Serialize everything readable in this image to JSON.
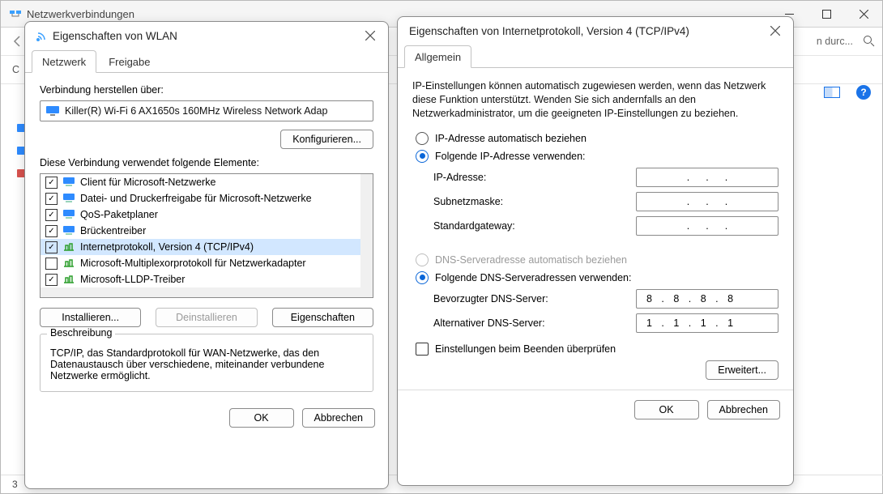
{
  "mainwin": {
    "title": "Netzwerkverbindungen",
    "back_icon": "arrow-left-icon",
    "search_placeholder": "n durc...",
    "status_count": "3"
  },
  "wlan": {
    "title": "Eigenschaften von WLAN",
    "tabs": {
      "network": "Netzwerk",
      "sharing": "Freigabe"
    },
    "connect_using": "Verbindung herstellen über:",
    "adapter": "Killer(R) Wi-Fi 6 AX1650s 160MHz Wireless Network Adap",
    "configure": "Konfigurieren...",
    "uses_items": "Diese Verbindung verwendet folgende Elemente:",
    "items": [
      {
        "checked": true,
        "label": "Client für Microsoft-Netzwerke"
      },
      {
        "checked": true,
        "label": "Datei- und Druckerfreigabe für Microsoft-Netzwerke"
      },
      {
        "checked": true,
        "label": "QoS-Paketplaner"
      },
      {
        "checked": true,
        "label": "Brückentreiber"
      },
      {
        "checked": true,
        "label": "Internetprotokoll, Version 4 (TCP/IPv4)",
        "selected": true
      },
      {
        "checked": false,
        "label": "Microsoft-Multiplexorprotokoll für Netzwerkadapter"
      },
      {
        "checked": true,
        "label": "Microsoft-LLDP-Treiber"
      }
    ],
    "install": "Installieren...",
    "uninstall": "Deinstallieren",
    "properties": "Eigenschaften",
    "desc_title": "Beschreibung",
    "desc_body": "TCP/IP, das Standardprotokoll für WAN-Netzwerke, das den Datenaustausch über verschiedene, miteinander verbundene Netzwerke ermöglicht.",
    "ok": "OK",
    "cancel": "Abbrechen"
  },
  "ipv4": {
    "title": "Eigenschaften von Internetprotokoll, Version 4 (TCP/IPv4)",
    "tab_general": "Allgemein",
    "hint": "IP-Einstellungen können automatisch zugewiesen werden, wenn das Netzwerk diese Funktion unterstützt. Wenden Sie sich andernfalls an den Netzwerkadministrator, um die geeigneten IP-Einstellungen zu beziehen.",
    "ip_auto": "IP-Adresse automatisch beziehen",
    "ip_manual": "Folgende IP-Adresse verwenden:",
    "lbl_ip": "IP-Adresse:",
    "lbl_mask": "Subnetzmaske:",
    "lbl_gw": "Standardgateway:",
    "dns_auto": "DNS-Serveradresse automatisch beziehen",
    "dns_manual": "Folgende DNS-Serveradressen verwenden:",
    "lbl_dns1": "Bevorzugter DNS-Server:",
    "lbl_dns2": "Alternativer DNS-Server:",
    "dns1": "8 . 8 . 8 . 8",
    "dns2": "1 . 1 . 1 . 1",
    "validate_exit": "Einstellungen beim Beenden überprüfen",
    "advanced": "Erweitert...",
    "ok": "OK",
    "cancel": "Abbrechen"
  }
}
